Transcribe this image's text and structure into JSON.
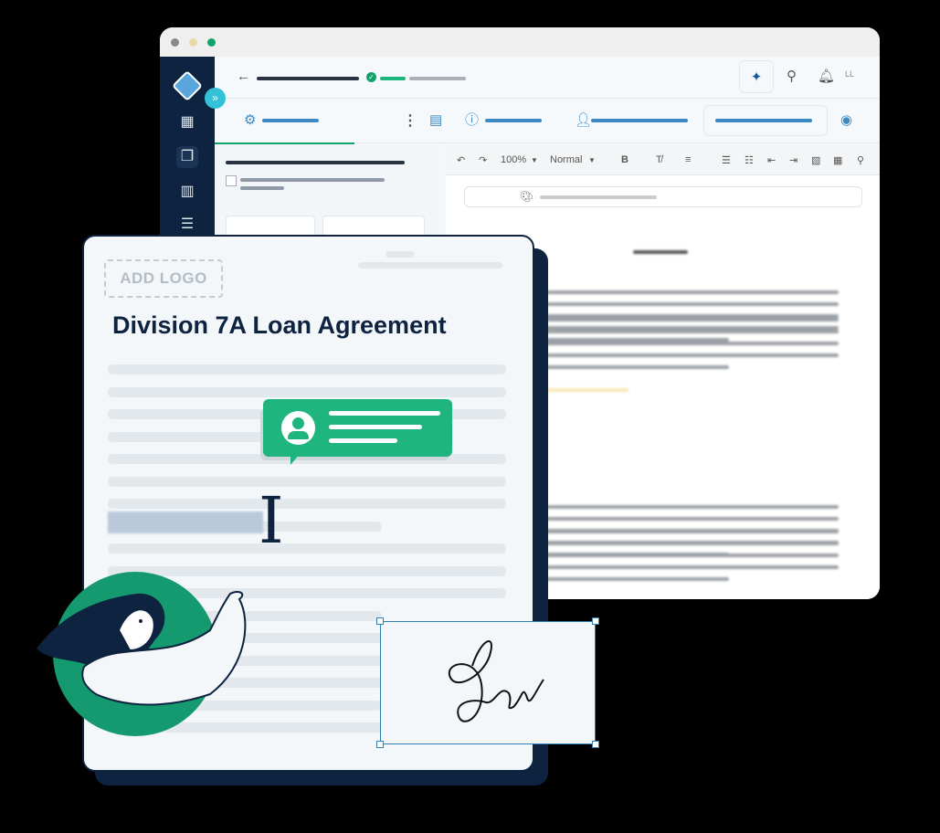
{
  "window": {
    "controls": [
      "close",
      "minimize",
      "maximize"
    ],
    "avatar_initials": "LL"
  },
  "sidebar": {
    "items": [
      {
        "icon": "dashboard-icon"
      },
      {
        "icon": "documents-icon",
        "active": true
      },
      {
        "icon": "building-icon"
      },
      {
        "icon": "checklist-icon"
      }
    ]
  },
  "editor_toolbar": {
    "zoom": "100%",
    "style": "Normal",
    "bold": "B"
  },
  "document": {
    "logo_placeholder": "ADD LOGO",
    "title": "Division 7A Loan Agreement"
  },
  "colors": {
    "navy": "#0d2340",
    "green": "#1fb57f",
    "accent_blue": "#3b8ac4"
  }
}
